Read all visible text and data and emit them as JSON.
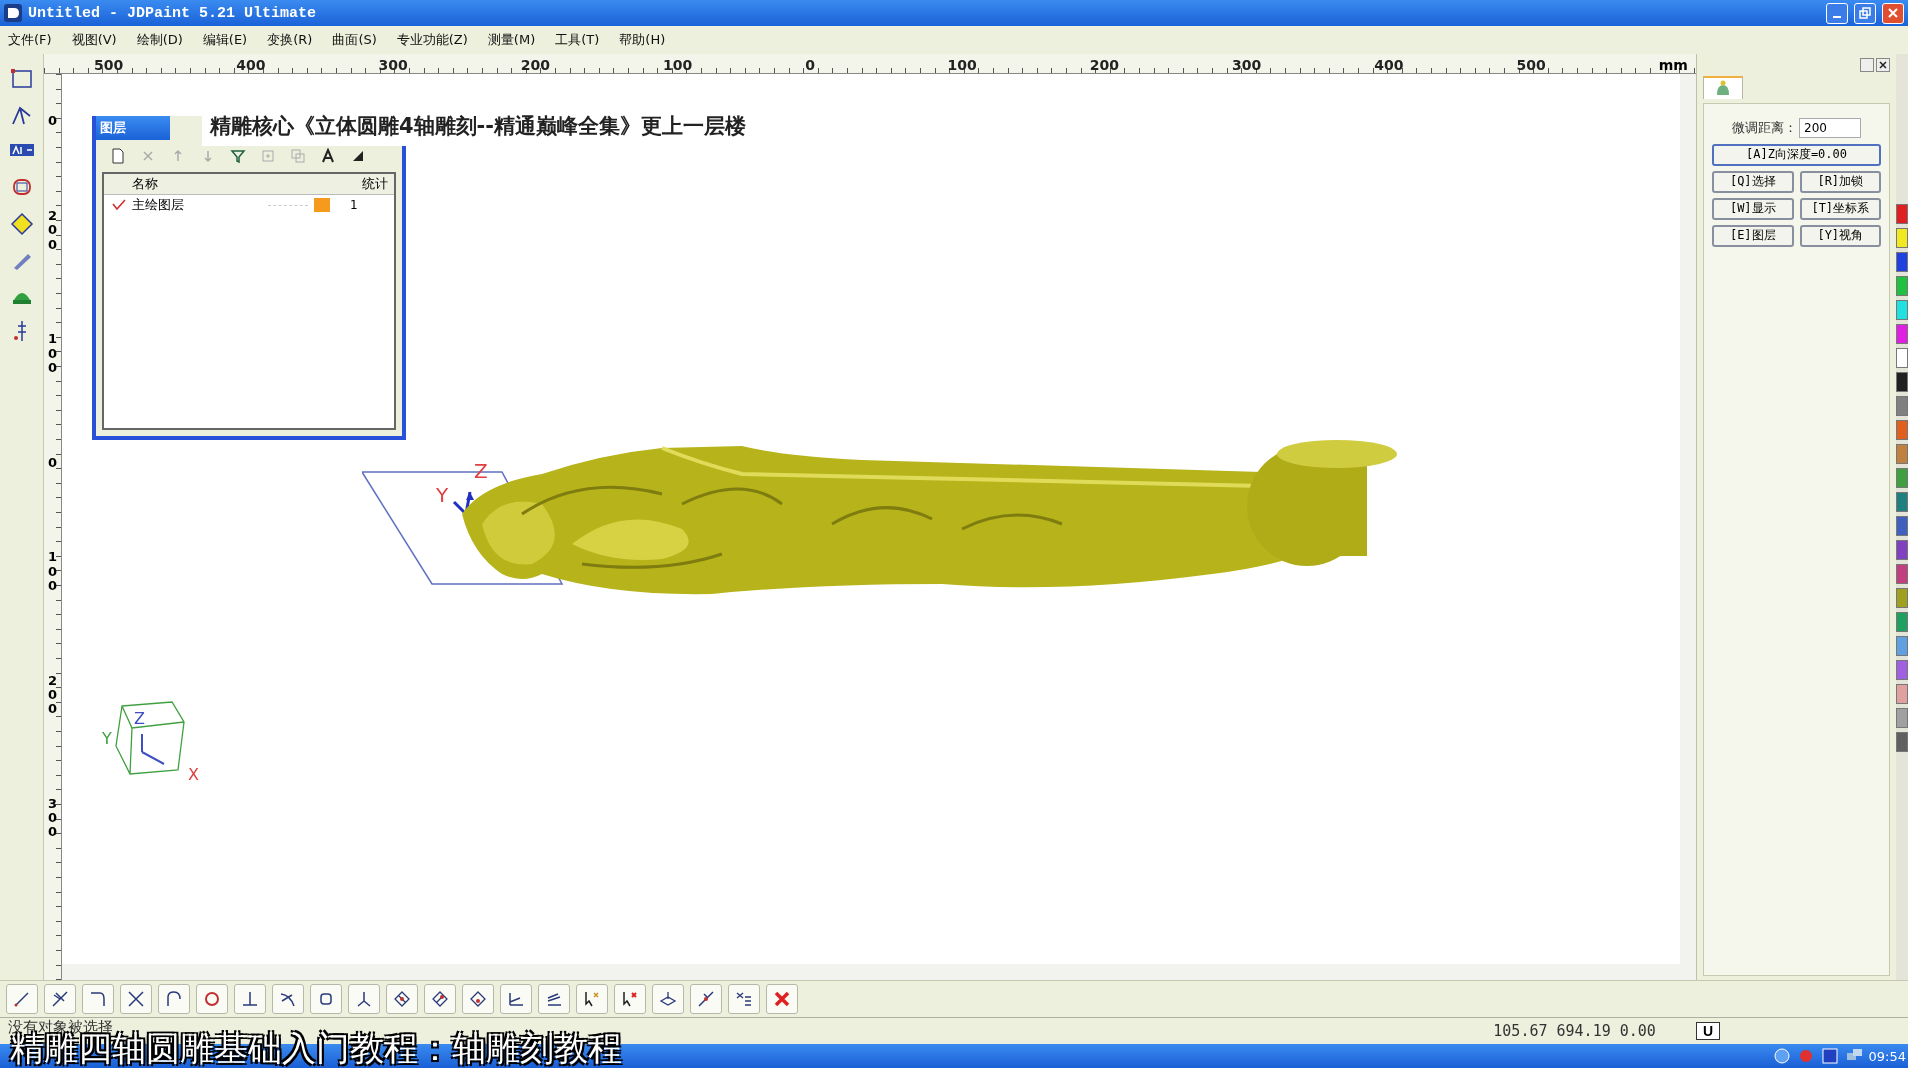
{
  "window": {
    "title": "Untitled - JDPaint 5.21 Ultimate"
  },
  "menu": [
    "文件(F)",
    "视图(V)",
    "绘制(D)",
    "编辑(E)",
    "变换(R)",
    "曲面(S)",
    "专业功能(Z)",
    "测量(M)",
    "工具(T)",
    "帮助(H)"
  ],
  "ruler": {
    "top_labels": [
      "500",
      "400",
      "300",
      "200",
      "100",
      "0",
      "100",
      "200",
      "300",
      "400",
      "500"
    ],
    "unit": "mm",
    "left_labels": [
      "0",
      "200",
      "100",
      "0",
      "100",
      "200",
      "300"
    ]
  },
  "overlay_title": "精雕核心《立体圆雕4轴雕刻--精通巅峰全集》更上一层楼",
  "layer_panel": {
    "title": "图层",
    "columns": [
      "名称",
      "统计"
    ],
    "rows": [
      {
        "name": "主绘图层",
        "checked": true,
        "color": "#f59a1c",
        "count": "1"
      }
    ]
  },
  "canvas": {
    "gizmo_labels": [
      "Y",
      "Z"
    ],
    "view_cube_labels": [
      "Z",
      "Y",
      "X"
    ]
  },
  "right_panel": {
    "field_label": "微调距离：",
    "field_value": "200",
    "buttons": [
      {
        "label": "[A]Z向深度=0.00",
        "kind": "wide"
      },
      {
        "label": "[Q]选择",
        "kind": "half"
      },
      {
        "label": "[R]加锁",
        "kind": "half"
      },
      {
        "label": "[W]显示",
        "kind": "half"
      },
      {
        "label": "[T]坐标系",
        "kind": "half"
      },
      {
        "label": "[E]图层",
        "kind": "half"
      },
      {
        "label": "[Y]视角",
        "kind": "half"
      }
    ]
  },
  "palette": [
    {
      "color": "#e02020"
    },
    {
      "color": "#f0e820"
    },
    {
      "color": "#2040e0"
    },
    {
      "color": "#20c040"
    },
    {
      "color": "#20e0e0"
    },
    {
      "color": "#e020e0"
    },
    {
      "color": "#ffffff"
    },
    {
      "color": "#202020"
    },
    {
      "color": "#808080"
    },
    {
      "color": "#e06020"
    },
    {
      "color": "#c08040"
    },
    {
      "color": "#40a040"
    },
    {
      "color": "#208080"
    },
    {
      "color": "#4060c0"
    },
    {
      "color": "#8040c0"
    },
    {
      "color": "#c04080"
    },
    {
      "color": "#a0a020"
    },
    {
      "color": "#20a060"
    },
    {
      "color": "#60a0e0"
    },
    {
      "color": "#a060e0"
    },
    {
      "color": "#e0a0a0"
    },
    {
      "color": "#a0a0a0"
    },
    {
      "color": "#606060"
    }
  ],
  "status_bar": {
    "message": "没有对象被选择",
    "coordinates": "105.67 694.19 0.00",
    "unit_button": "U"
  },
  "taskbar": {
    "clock": "09:54"
  },
  "caption": "精雕四轴圆雕基础入门教程：轴雕刻教程"
}
